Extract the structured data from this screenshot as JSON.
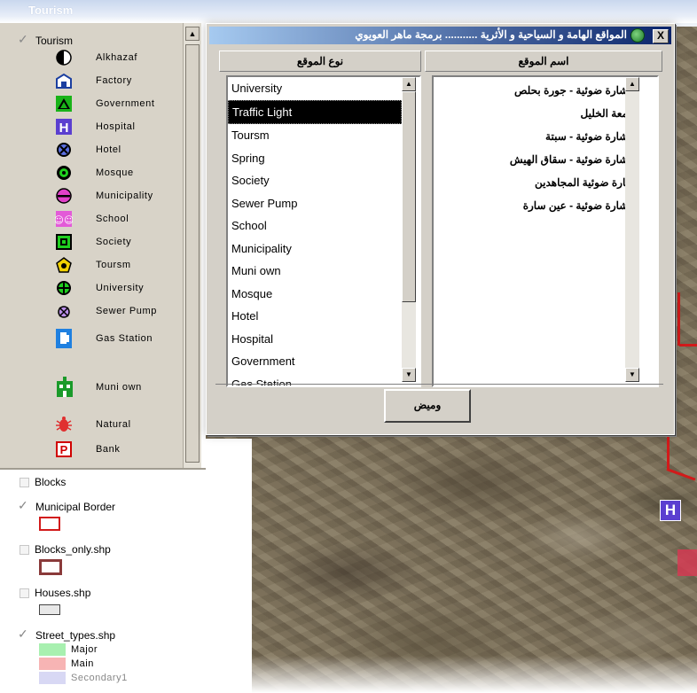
{
  "banner": {
    "title": "Tourism"
  },
  "toc": {
    "group": {
      "label": "Tourism",
      "checked": true
    },
    "legend": [
      {
        "label": "Alkhazaf",
        "icon": "half-circle-icon"
      },
      {
        "label": "Factory",
        "icon": "factory-icon"
      },
      {
        "label": "Government",
        "icon": "government-triangle-icon"
      },
      {
        "label": "Hospital",
        "icon": "hospital-h-icon"
      },
      {
        "label": "Hotel",
        "icon": "hotel-circle-x-icon"
      },
      {
        "label": "Mosque",
        "icon": "mosque-circle-icon"
      },
      {
        "label": "Municipality",
        "icon": "municipality-circle-icon"
      },
      {
        "label": "School",
        "icon": "school-children-icon"
      },
      {
        "label": "Society",
        "icon": "society-square-icon"
      },
      {
        "label": "Toursm",
        "icon": "tourism-pentagon-icon"
      },
      {
        "label": "University",
        "icon": "university-crosshair-icon"
      },
      {
        "label": "Sewer Pump",
        "icon": "sewer-pump-icon"
      },
      {
        "label": "Gas Station",
        "icon": "gas-station-icon"
      },
      {
        "label": "Muni own",
        "icon": "muni-own-building-icon"
      },
      {
        "label": "Natural",
        "icon": "natural-bug-icon"
      },
      {
        "label": "Bank",
        "icon": "bank-p-icon"
      }
    ],
    "layers": [
      {
        "label": "Blocks",
        "checked": false
      },
      {
        "label": "Municipal Border",
        "checked": true,
        "swatch": "#d21a1a"
      },
      {
        "label": "Blocks_only.shp",
        "checked": false,
        "swatch": "#8a3a3a"
      },
      {
        "label": "Houses.shp",
        "checked": false,
        "swatch": "#444444"
      },
      {
        "label": "Street_types.shp",
        "checked": true
      }
    ],
    "streets": [
      {
        "label": "Major",
        "color": "#a8f0b0"
      },
      {
        "label": "Main",
        "color": "#f7b4b4"
      },
      {
        "label": "Secondary1",
        "color": "#d8d8f4"
      }
    ]
  },
  "dialog": {
    "title": "المواقع الهامة و السياحية و الأثرية ........... برمجة ماهر العويوي",
    "close_label": "X",
    "type_header": "نوع الموقع",
    "name_header": "اسم الموقع",
    "types": [
      "University",
      "Traffic Light",
      "Toursm",
      "Spring",
      "Society",
      "Sewer Pump",
      "School",
      "Municipality",
      "Muni own",
      "Mosque",
      "Hotel",
      "Hospital",
      "Government",
      "Gas Station"
    ],
    "selected_type": "Traffic Light",
    "names": [
      "- اشارة ضوئية - جورة بحلص",
      "جامعة الخليل",
      "- اشارة ضوئية - سبتة",
      "- اشارة ضوئية - سقاق الهيش",
      "اشارة ضوئية المجاهدين",
      "- اشارة ضوئية - عين سارة"
    ],
    "button_label": "وميض"
  },
  "colors": {
    "titlebar_dark": "#0a246a",
    "titlebar_light": "#a6caf0",
    "selection": "#000000",
    "border_red": "#d21a1a"
  }
}
